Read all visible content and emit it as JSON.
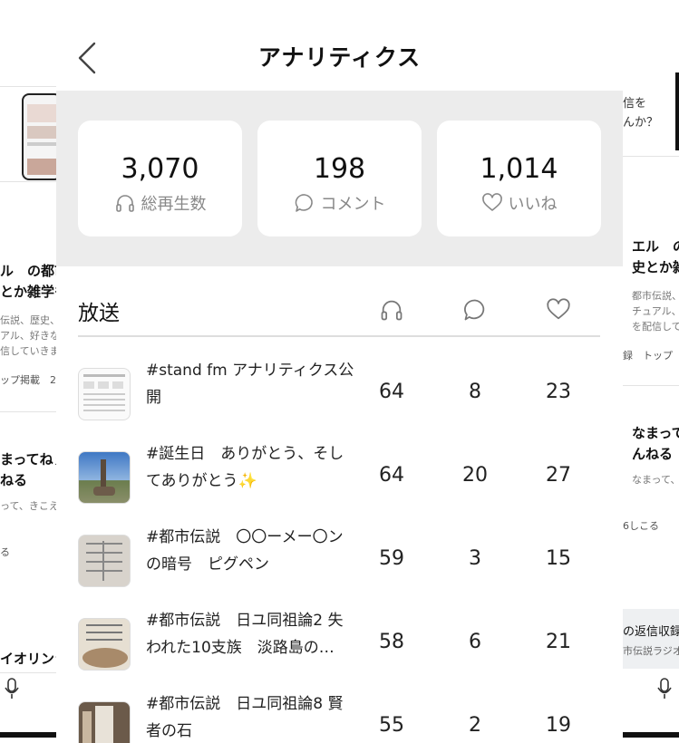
{
  "header": {
    "title": "アナリティクス"
  },
  "stats": [
    {
      "value": "3,070",
      "label": "総再生数",
      "icon": "headphones-icon"
    },
    {
      "value": "198",
      "label": "コメント",
      "icon": "comment-icon"
    },
    {
      "value": "1,014",
      "label": "いいね",
      "icon": "heart-icon"
    }
  ],
  "list": {
    "title": "放送",
    "rows": [
      {
        "title": "#stand fm アナリティクス公開",
        "plays": "64",
        "comments": "8",
        "likes": "23"
      },
      {
        "title": "#誕生日　ありがとう、そしてありがとう✨",
        "plays": "64",
        "comments": "20",
        "likes": "27"
      },
      {
        "title": "#都市伝説　〇〇ーメー〇ンの暗号　ピグペン",
        "plays": "59",
        "comments": "3",
        "likes": "15"
      },
      {
        "title": "#都市伝説　日ユ同祖論2 失われた10支族　淡路島の…",
        "plays": "58",
        "comments": "6",
        "likes": "21"
      },
      {
        "title": "#都市伝説　日ユ同祖論8 賢者の石",
        "plays": "55",
        "comments": "2",
        "likes": "19"
      }
    ]
  },
  "left_page": {
    "heading_1": "ル　の都市",
    "heading_2": "とか雑学も",
    "desc_1": "伝説、歴史、",
    "desc_2": "アル、好きな",
    "desc_3": "信していきま",
    "meta": "ップ掲載　2",
    "item2_title_1": "まってねぇ",
    "item2_title_2": "ねる",
    "item2_sub": "って、きこえ",
    "item2_meta": "る",
    "item3_title": "イオリンラ"
  },
  "right_page": {
    "top_1": "信を",
    "top_2": "んか？",
    "heading_1": "エル　の",
    "heading_2": "史とか雑",
    "desc_1": "都市伝説、",
    "desc_2": "チュアル、",
    "desc_3": "を配信して",
    "meta": "録　トップ",
    "item2_title_1": "なまって",
    "item2_title_2": "んねる",
    "item2_sub": "なまって、",
    "item2_meta": "6しこる",
    "banner_1": "の返信収録",
    "banner_2": "市伝説ラジオ"
  }
}
